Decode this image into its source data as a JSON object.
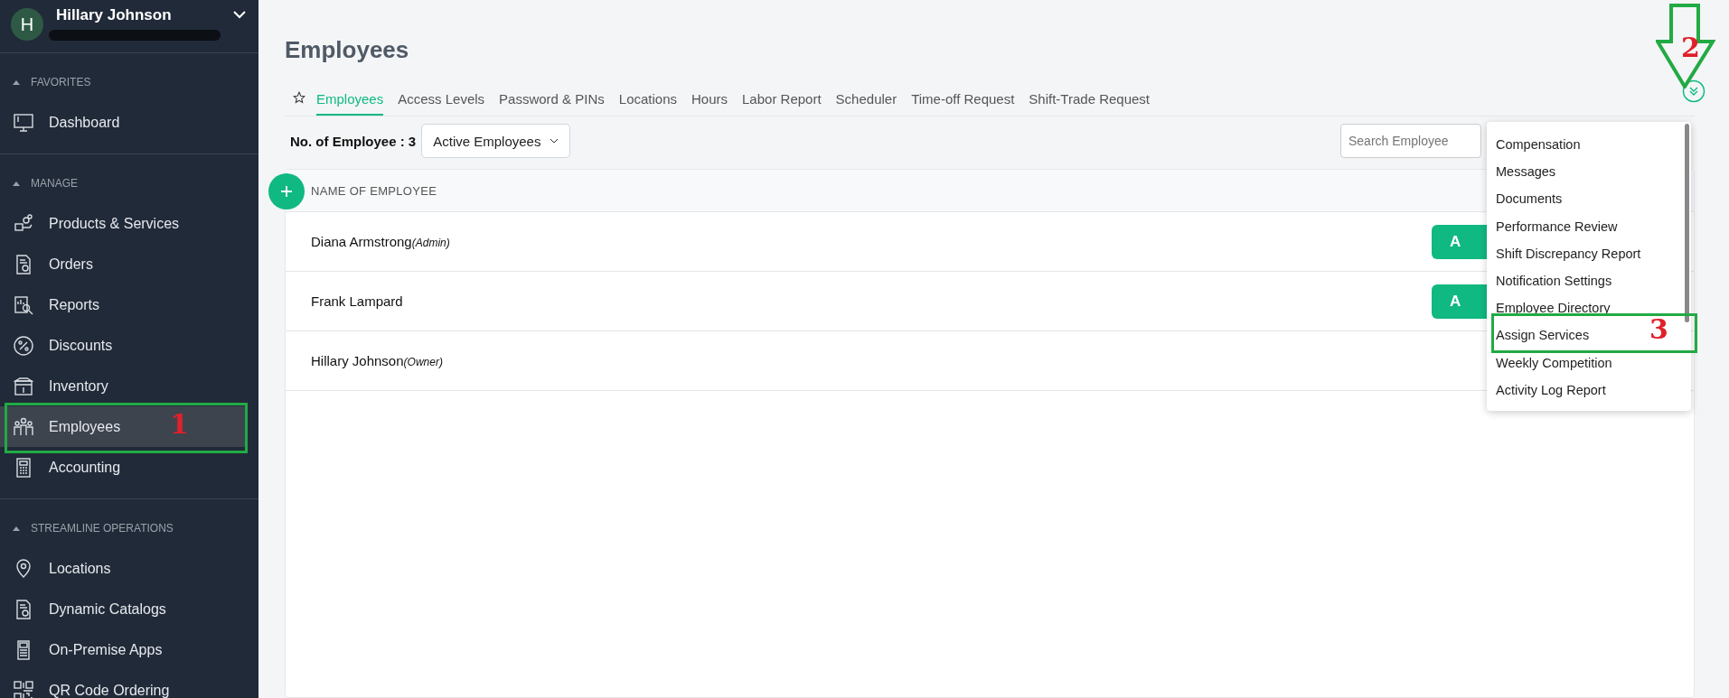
{
  "user": {
    "initial": "H",
    "name": "Hillary Johnson"
  },
  "sidebar": {
    "sections": [
      {
        "title": "FAVORITES",
        "items": [
          {
            "label": "Dashboard",
            "selected": false
          }
        ]
      },
      {
        "title": "MANAGE",
        "items": [
          {
            "label": "Products & Services",
            "selected": false
          },
          {
            "label": "Orders",
            "selected": false
          },
          {
            "label": "Reports",
            "selected": false
          },
          {
            "label": "Discounts",
            "selected": false
          },
          {
            "label": "Inventory",
            "selected": false
          },
          {
            "label": "Employees",
            "selected": true
          },
          {
            "label": "Accounting",
            "selected": false
          }
        ]
      },
      {
        "title": "STREAMLINE OPERATIONS",
        "items": [
          {
            "label": "Locations",
            "selected": false
          },
          {
            "label": "Dynamic Catalogs",
            "selected": false
          },
          {
            "label": "On-Premise Apps",
            "selected": false
          },
          {
            "label": "QR Code Ordering",
            "selected": false
          }
        ]
      }
    ]
  },
  "page_title": "Employees",
  "tabs": [
    {
      "label": "Employees",
      "selected": true
    },
    {
      "label": "Access Levels",
      "selected": false
    },
    {
      "label": "Password & PINs",
      "selected": false
    },
    {
      "label": "Locations",
      "selected": false
    },
    {
      "label": "Hours",
      "selected": false
    },
    {
      "label": "Labor Report",
      "selected": false
    },
    {
      "label": "Scheduler",
      "selected": false
    },
    {
      "label": "Time-off Request",
      "selected": false
    },
    {
      "label": "Shift-Trade Request",
      "selected": false
    }
  ],
  "count_label": "No. of Employee : 3",
  "filter": {
    "value": "Active Employees"
  },
  "search": {
    "placeholder": "Search Employee"
  },
  "table": {
    "columns": [
      "NAME OF EMPLOYEE"
    ],
    "rows": [
      {
        "name": "Diana Armstrong",
        "role": "(Admin)",
        "action": "A"
      },
      {
        "name": "Frank Lampard",
        "action": "A"
      },
      {
        "name": "Hillary Johnson",
        "role": "(Owner)"
      }
    ]
  },
  "more_menu": {
    "items": [
      {
        "label": "Compensation"
      },
      {
        "label": "Messages"
      },
      {
        "label": "Documents"
      },
      {
        "label": "Performance Review"
      },
      {
        "label": "Shift Discrepancy Report"
      },
      {
        "label": "Notification Settings"
      },
      {
        "label": "Employee Directory"
      },
      {
        "label": "Assign Services"
      },
      {
        "label": "Weekly Competition"
      },
      {
        "label": "Activity Log Report"
      }
    ]
  },
  "annotations": [
    {
      "label": "1"
    },
    {
      "label": "2"
    },
    {
      "label": "3"
    }
  ]
}
